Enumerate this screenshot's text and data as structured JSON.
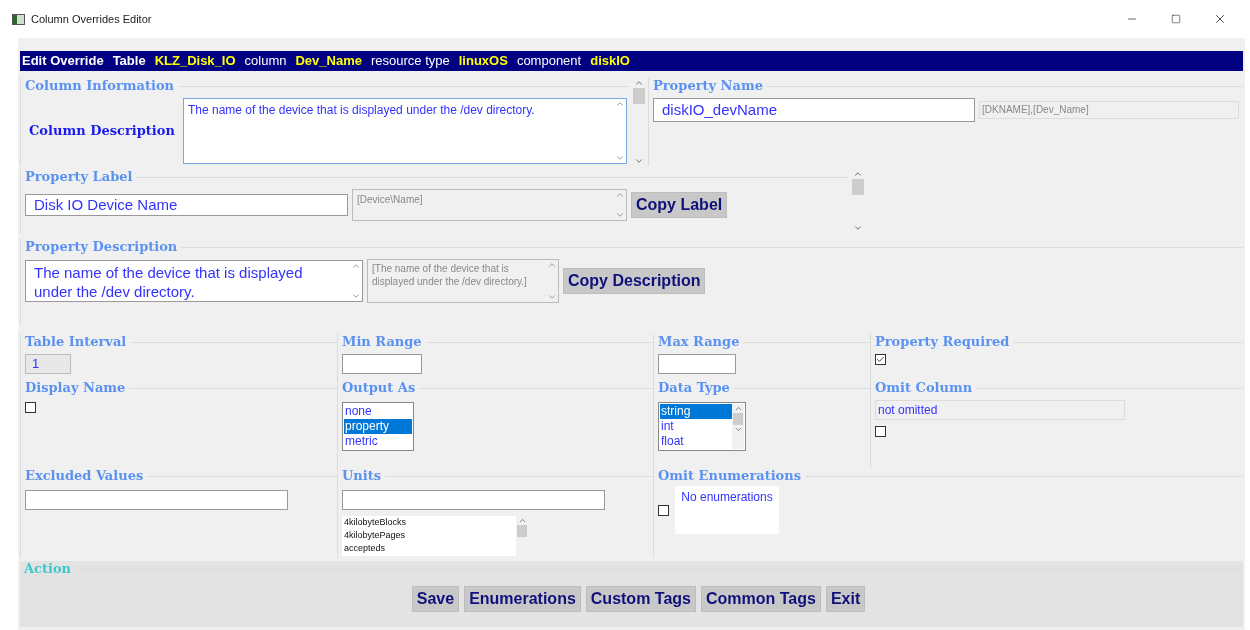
{
  "window": {
    "title": "Column Overrides Editor"
  },
  "header": [
    {
      "text": "Edit Override",
      "kind": "title"
    },
    {
      "text": "Table",
      "kind": "title"
    },
    {
      "text": "KLZ_Disk_IO",
      "kind": "value"
    },
    {
      "text": "column",
      "kind": "key"
    },
    {
      "text": "Dev_Name",
      "kind": "value"
    },
    {
      "text": "resource type",
      "kind": "key"
    },
    {
      "text": "linuxOS",
      "kind": "value"
    },
    {
      "text": "component",
      "kind": "key"
    },
    {
      "text": "diskIO",
      "kind": "value"
    }
  ],
  "column_information": {
    "legend": "Column Information",
    "label": "Column Description",
    "description": "The name of the device that is displayed under the /dev directory."
  },
  "property_name": {
    "legend": "Property Name",
    "value": "diskIO_devName",
    "hint": "[DKNAME],[Dev_Name]"
  },
  "property_label": {
    "legend": "Property Label",
    "value": "Disk IO Device Name",
    "hint": "[Device\\Name]",
    "button": "Copy Label"
  },
  "property_description": {
    "legend": "Property Description",
    "value": "The name of the device that is displayed under the /dev directory.",
    "hint": "[The name of the device that is displayed under the /dev directory.]",
    "button": "Copy Description"
  },
  "table_interval": {
    "legend": "Table Interval",
    "value": "1"
  },
  "min_range": {
    "legend": "Min Range"
  },
  "max_range": {
    "legend": "Max Range"
  },
  "property_required": {
    "legend": "Property Required",
    "checked": true
  },
  "display_name": {
    "legend": "Display Name",
    "checked": false
  },
  "output_as": {
    "legend": "Output As",
    "options": [
      {
        "label": "none",
        "selected": false
      },
      {
        "label": "property",
        "selected": true
      },
      {
        "label": "metric",
        "selected": false
      }
    ]
  },
  "data_type": {
    "legend": "Data Type",
    "options": [
      {
        "label": "string",
        "selected": true
      },
      {
        "label": "int",
        "selected": false
      },
      {
        "label": "float",
        "selected": false
      }
    ]
  },
  "omit_column": {
    "legend": "Omit Column",
    "value": "not omitted",
    "checked": false
  },
  "excluded_values": {
    "legend": "Excluded Values"
  },
  "units": {
    "legend": "Units",
    "options": [
      "4kilobyteBlocks",
      "4kilobytePages",
      "accepteds"
    ]
  },
  "omit_enumerations": {
    "legend": "Omit Enumerations",
    "checked": false,
    "text": "No enumerations"
  },
  "action": {
    "legend": "Action",
    "buttons": [
      "Save",
      "Enumerations",
      "Custom Tags",
      "Common Tags",
      "Exit"
    ]
  }
}
